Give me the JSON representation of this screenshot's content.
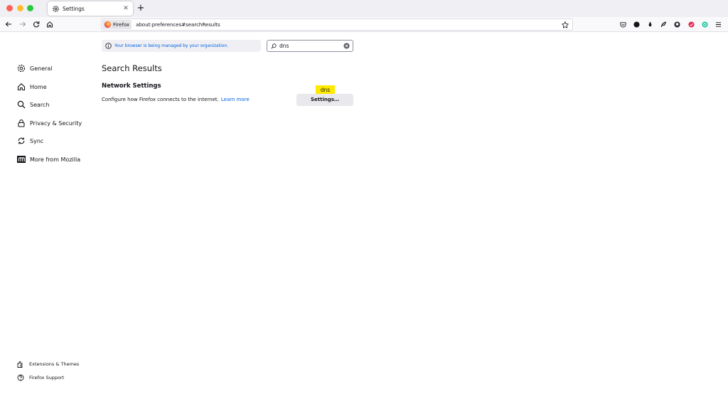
{
  "tab": {
    "title": "Settings",
    "close_glyph": "✕"
  },
  "newtab": {
    "glyph": "+"
  },
  "urlbar": {
    "identity_label": "Firefox",
    "url": "about:preferences#searchResults"
  },
  "sidebar": {
    "items": [
      {
        "label": "General",
        "icon": "gear-icon"
      },
      {
        "label": "Home",
        "icon": "home-icon"
      },
      {
        "label": "Search",
        "icon": "magnifier-icon"
      },
      {
        "label": "Privacy & Security",
        "icon": "lock-icon"
      },
      {
        "label": "Sync",
        "icon": "sync-icon"
      },
      {
        "label": "More from Mozilla",
        "icon": "mozilla-icon"
      }
    ],
    "footer": [
      {
        "label": "Extensions & Themes",
        "icon": "puzzle-icon"
      },
      {
        "label": "Firefox Support",
        "icon": "help-icon"
      }
    ]
  },
  "policy_notice": {
    "text": "Your browser is being managed by your organization."
  },
  "search": {
    "value": "dns"
  },
  "main": {
    "heading": "Search Results",
    "section_title": "Network Settings",
    "description": "Configure how Firefox connects to the internet.",
    "learn_more": "Learn more",
    "highlight_label": "dns",
    "settings_button": "Settings…"
  },
  "colors": {
    "link": "#0061e0",
    "highlight": "#ffe900",
    "button_bg": "#e9e9ed"
  }
}
